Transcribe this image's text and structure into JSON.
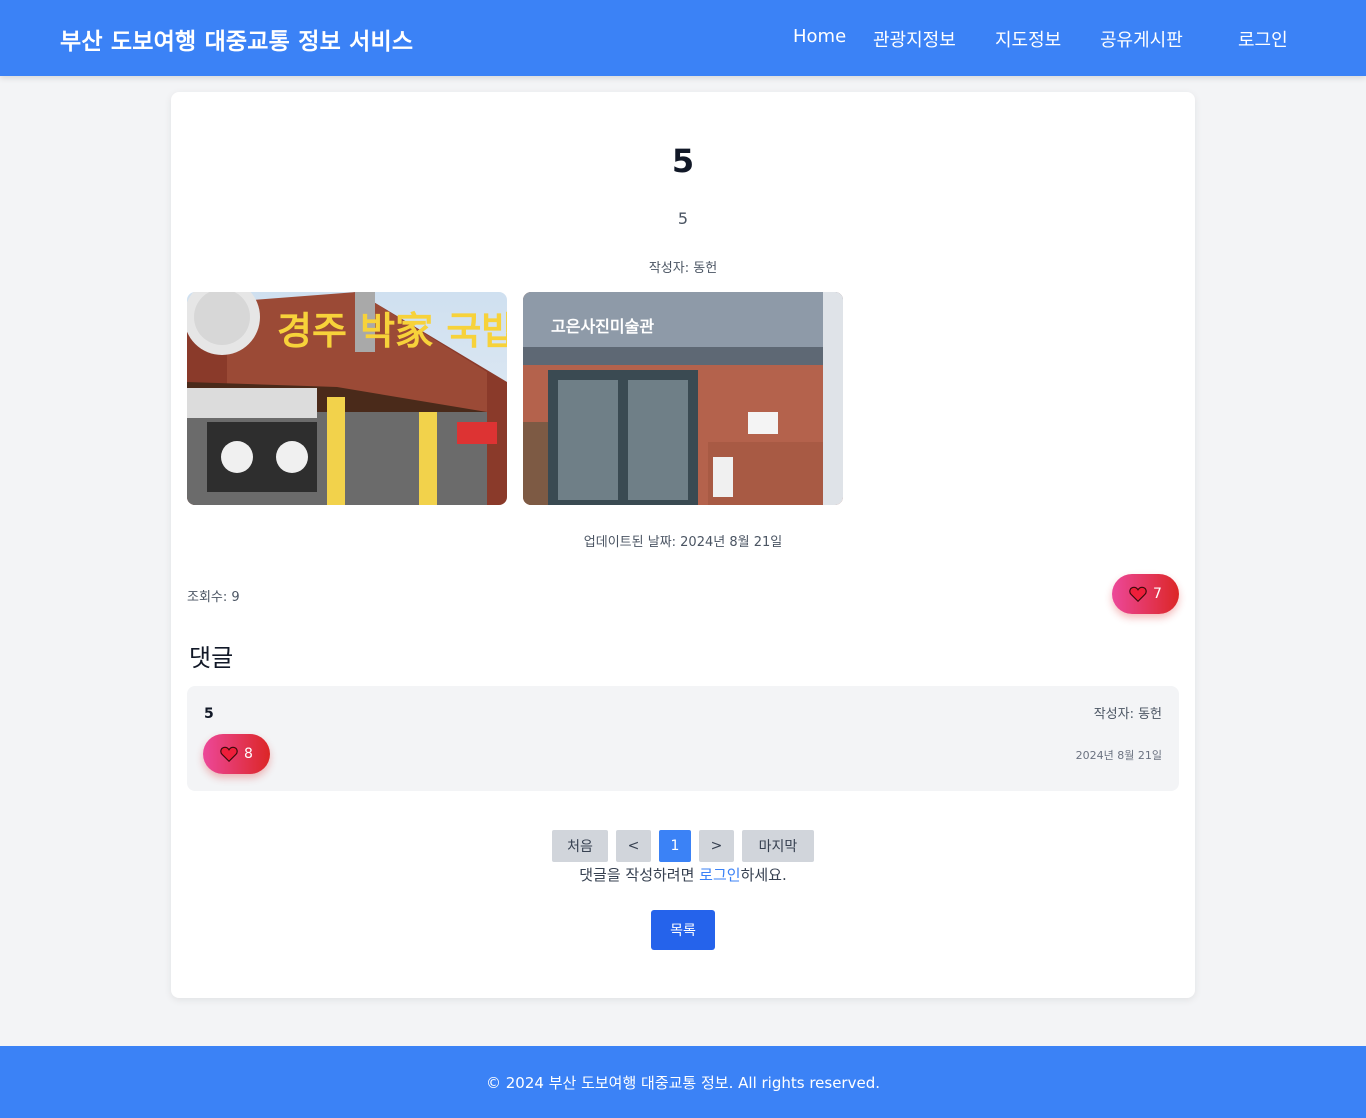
{
  "header": {
    "brand": "부산 도보여행 대중교통 정보 서비스",
    "nav": [
      "Home",
      "관광지정보",
      "지도정보",
      "공유게시판",
      "로그인"
    ],
    "color": "#3b82f6"
  },
  "post": {
    "title": "5",
    "body": "5",
    "author": "작성자: 동헌",
    "images": [
      {
        "icon": "restaurant-storefront-photo",
        "sign_text": "경주 박家 국밥"
      },
      {
        "icon": "gallery-entrance-photo",
        "sign_text": "고은사진미술관"
      }
    ],
    "updated": "업데이트된 날짜: 2024년 8월 21일",
    "views": "조회수: 9",
    "likes": "7"
  },
  "comments": {
    "heading": "댓글",
    "items": [
      {
        "text": "5",
        "author": "작성자: 동헌",
        "date": "2024년 8월 21일",
        "likes": "8"
      }
    ]
  },
  "pagination": {
    "first": "처음",
    "prev": "<",
    "current": "1",
    "next": ">",
    "last": "마지막"
  },
  "login_notice": {
    "prefix": "댓글을 작성하려면 ",
    "link": "로그인",
    "suffix": "하세요."
  },
  "list_button": "목록",
  "footer": {
    "text": "© 2024 부산 도보여행 대중교통 정보. All rights reserved."
  },
  "colors": {
    "accent": "#3b82f6",
    "primary_button": "#2563eb",
    "like_gradient_start": "#ec4899",
    "like_gradient_end": "#dc2626"
  }
}
